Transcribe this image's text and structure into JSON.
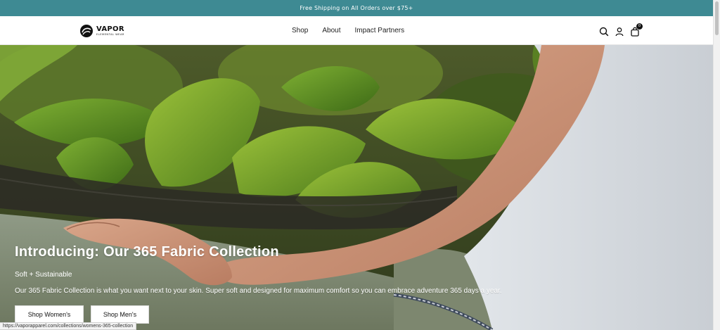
{
  "colors": {
    "announcement_bar": "#3e8a93",
    "button_bg": "#ffffff",
    "hero_text": "#ffffff"
  },
  "announcement": {
    "text": "Free Shipping on All Orders over $75+"
  },
  "brand": {
    "name": "VAPOR",
    "tagline": "ELEMENTAL WEAR",
    "icon": "vapor-swirl-logo"
  },
  "nav": {
    "items": [
      "Shop",
      "About",
      "Impact Partners"
    ]
  },
  "header_icons": {
    "search": "search-icon",
    "account": "user-icon",
    "cart": "bag-icon",
    "cart_count": "0"
  },
  "hero": {
    "title": "Introducing: Our 365 Fabric Collection",
    "subtitle": "Soft + Sustainable",
    "description": "Our 365 Fabric Collection is what you want next to your skin. Super soft and designed for maximum comfort so you can embrace adventure 365 days a year.",
    "buttons": {
      "womens": "Shop Women's",
      "mens": "Shop Men's"
    }
  },
  "status_bar": {
    "url": "https://vaporapparel.com/collections/womens-365-collection"
  }
}
